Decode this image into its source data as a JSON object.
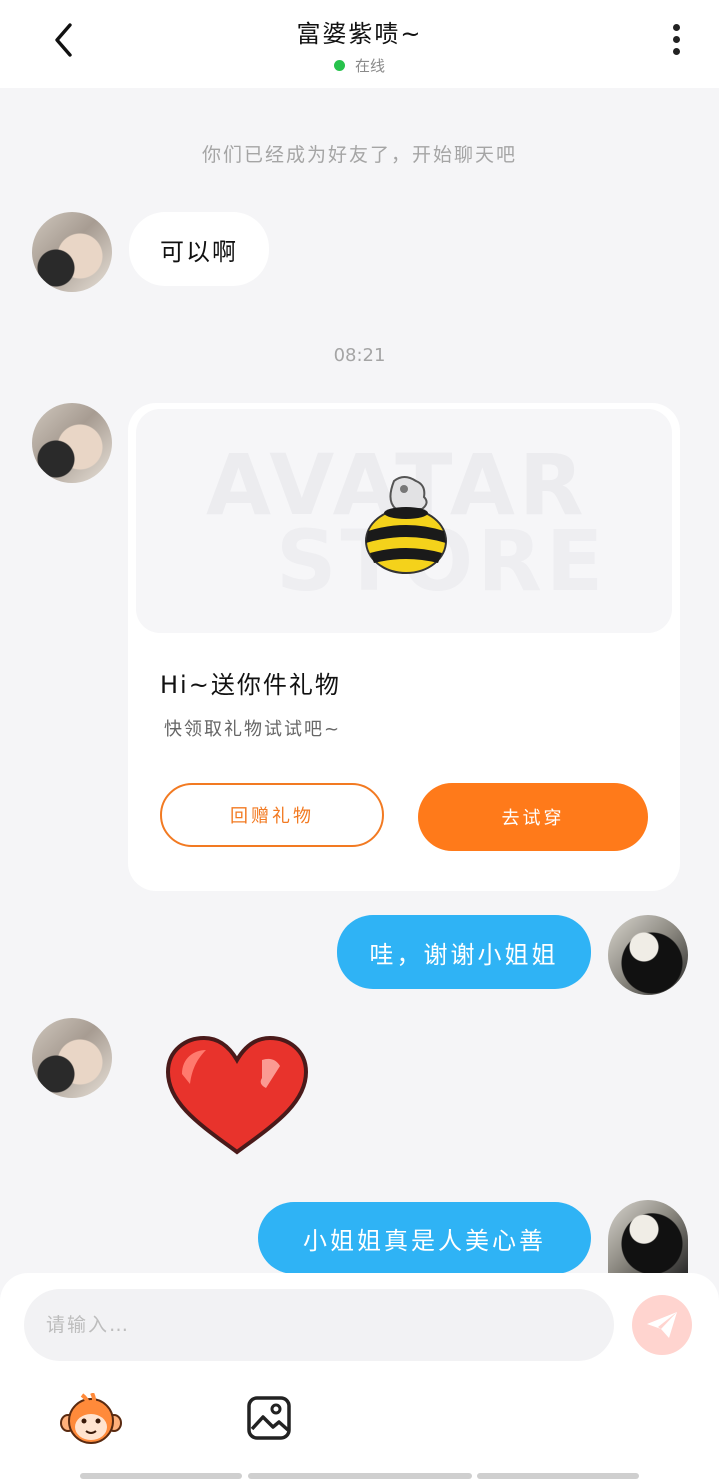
{
  "header": {
    "title": "富婆紫啧~",
    "status": "在线",
    "status_color": "#27c24c"
  },
  "chat": {
    "system_notice": "你们已经成为好友了，开始聊天吧",
    "time_label": "08:21",
    "messages": [
      {
        "from": "other",
        "type": "text",
        "text": "可以啊"
      },
      {
        "from": "other",
        "type": "gift",
        "watermark_line1": "AVATAR",
        "watermark_line2": "STORE",
        "title": "Hi~送你件礼物",
        "subtitle": "快领取礼物试试吧~",
        "secondary_button": "回赠礼物",
        "primary_button": "去试穿"
      },
      {
        "from": "me",
        "type": "text",
        "text": "哇，谢谢小姐姐"
      },
      {
        "from": "other",
        "type": "sticker",
        "sticker": "heart-icon"
      },
      {
        "from": "me",
        "type": "text",
        "text": "小姐姐真是人美心善"
      }
    ]
  },
  "composer": {
    "placeholder": "请输入…",
    "icons": [
      "send-icon",
      "emoji-monkey-icon",
      "image-icon"
    ]
  },
  "colors": {
    "accent_orange": "#ff7a1a",
    "my_bubble": "#2fb3f5",
    "background": "#f5f5f7"
  }
}
